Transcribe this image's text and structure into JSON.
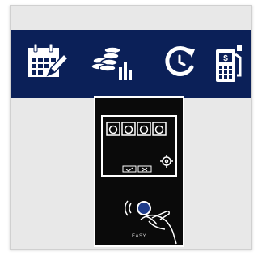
{
  "banner": {
    "background_color": "#0b2058",
    "icons": [
      {
        "name": "calendar-edit-icon"
      },
      {
        "name": "coins-chart-icon"
      },
      {
        "name": "clock-refresh-icon"
      },
      {
        "name": "fuel-pump-icon"
      }
    ]
  },
  "device": {
    "brand_text": "EASY",
    "screen_icons": [
      "washer-icon",
      "washer-icon",
      "washer-icon",
      "washer-icon"
    ],
    "buttons": [
      "check-button",
      "close-button"
    ]
  }
}
